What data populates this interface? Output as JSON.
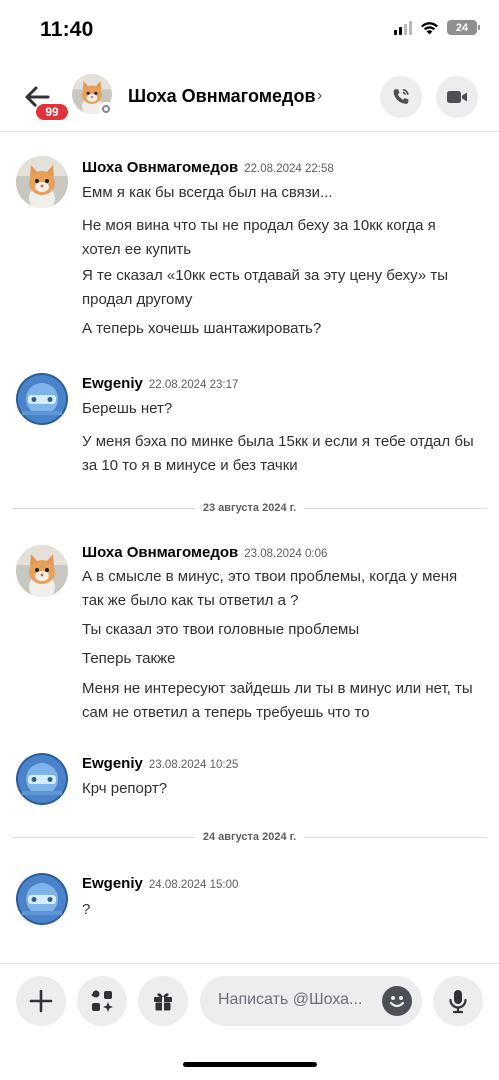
{
  "status_bar": {
    "time": "11:40",
    "battery": "24",
    "icons": [
      "signal-icon",
      "wifi-icon",
      "battery-icon"
    ]
  },
  "header": {
    "unread_badge": "99",
    "contact_name": "Шоха Овнмагомедов",
    "chevron": "›",
    "icons": [
      "back-arrow-icon",
      "phone-icon",
      "video-camera-icon"
    ]
  },
  "messages": [
    {
      "author": "Шоха Овнмагомедов",
      "timestamp": "22.08.2024 22:58",
      "avatar": "kitten-avatar",
      "lines": [
        "Емм я как бы всегда был на связи...",
        "Не моя вина что ты не продал беху за 10кк когда я хотел ее купить",
        "Я те сказал «10кк есть отдавай за эту цену беху» ты продал другому",
        "А теперь хочешь  шантажировать?"
      ]
    },
    {
      "author": "Ewgeniy",
      "timestamp": "22.08.2024 23:17",
      "avatar": "blue-abstract-avatar",
      "lines": [
        "Берешь нет?",
        "У меня бэха по минке была 15кк и если я тебе отдал бы за 10 то я в минусе и без тачки"
      ]
    },
    {
      "author": "Шоха Овнмагомедов",
      "timestamp": "23.08.2024 0:06",
      "avatar": "kitten-avatar",
      "lines": [
        "А в смысле в минус, это твои проблемы, когда у меня так же было как ты ответил а ?",
        "Ты сказал это твои головные проблемы",
        "Теперь также",
        "Меня не интересуют зайдешь ли ты в минус или нет, ты сам не ответил а теперь требуешь что то"
      ]
    },
    {
      "author": "Ewgeniy",
      "timestamp": "23.08.2024 10:25",
      "avatar": "blue-abstract-avatar",
      "lines": [
        "Крч репорт?"
      ]
    },
    {
      "author": "Ewgeniy",
      "timestamp": "24.08.2024 15:00",
      "avatar": "blue-abstract-avatar",
      "lines": [
        "?"
      ]
    }
  ],
  "dividers": [
    "23 августа 2024 г.",
    "24 августа 2024 г."
  ],
  "composer": {
    "placeholder": "Написать @Шоха...",
    "icons": [
      "plus-icon",
      "apps-icon",
      "gift-icon",
      "emoji-icon",
      "microphone-icon"
    ]
  }
}
